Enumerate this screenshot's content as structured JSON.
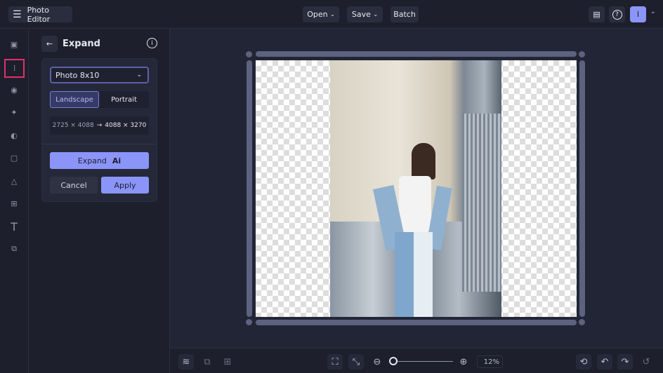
{
  "app": {
    "title": "Photo Editor"
  },
  "menu": {
    "open": "Open",
    "save": "Save",
    "batch": "Batch",
    "avatar_initial": "I"
  },
  "panel": {
    "title": "Expand",
    "preset": "Photo 8x10",
    "landscape": "Landscape",
    "portrait": "Portrait",
    "size_from": "2725 × 4088",
    "arrow": "→",
    "size_to": "4088 × 3270",
    "expand": "Expand",
    "ai_badge": "Ai",
    "cancel": "Cancel",
    "apply": "Apply"
  },
  "zoom": {
    "value": "12%",
    "level": 0.05
  },
  "colors": {
    "accent": "#8b95f8",
    "highlight": "#e0306a"
  }
}
